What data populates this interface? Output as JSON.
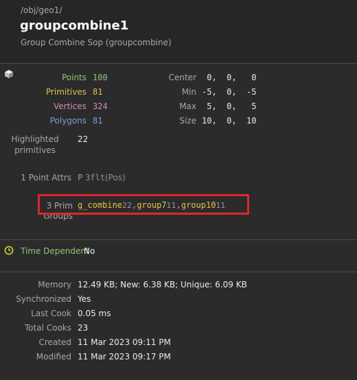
{
  "header": {
    "path": "/obj/geo1/",
    "node_name": "groupcombine1",
    "node_type": "Group Combine Sop (groupcombine)"
  },
  "geometry": {
    "points_label": "Points",
    "points_value": "100",
    "primitives_label": "Primitives",
    "primitives_value": "81",
    "vertices_label": "Vertices",
    "vertices_value": "324",
    "polygons_label": "Polygons",
    "polygons_value": "81",
    "center_label": "Center",
    "center_value": " 0,  0,   0",
    "min_label": "Min",
    "min_value": "-5,  0,  -5",
    "max_label": "Max",
    "max_value": " 5,  0,   5",
    "size_label": "Size",
    "size_value": "10,  0,  10",
    "highlighted_label_line1": "Highlighted",
    "highlighted_label_line2": "primitives",
    "highlighted_value": "22",
    "point_attrs_label": "1 Point Attrs",
    "point_attrs_class": "P",
    "point_attrs_type": "3flt",
    "point_attrs_name": "(Pos)",
    "prim_groups_label_line1": "3 Prim",
    "prim_groups_label_line2": "Groups",
    "prim_groups": [
      {
        "name": "g_combine",
        "count": "22"
      },
      {
        "name": "group7",
        "count": "11"
      },
      {
        "name": "group10",
        "count": "11"
      }
    ],
    "group_separator": ","
  },
  "time": {
    "label": "Time Dependent",
    "value": "No"
  },
  "stats": {
    "memory_label": "Memory",
    "memory_value": "12.49 KB; New: 6.38 KB; Unique: 6.09 KB",
    "synchronized_label": "Synchronized",
    "synchronized_value": "Yes",
    "last_cook_label": "Last Cook",
    "last_cook_value": "0.05 ms",
    "total_cooks_label": "Total Cooks",
    "total_cooks_value": "23",
    "created_label": "Created",
    "created_value": "11 Mar 2023 09:11 PM",
    "modified_label": "Modified",
    "modified_value": "11 Mar 2023 09:17 PM"
  },
  "colors": {
    "highlight_box": "#e0272a",
    "points": "#8ac971",
    "primitives": "#e0c04c",
    "vertices": "#d48dbd",
    "polygons": "#7f9ee0"
  },
  "icons": {
    "geometry": "cube-icon",
    "time": "clock-icon"
  }
}
